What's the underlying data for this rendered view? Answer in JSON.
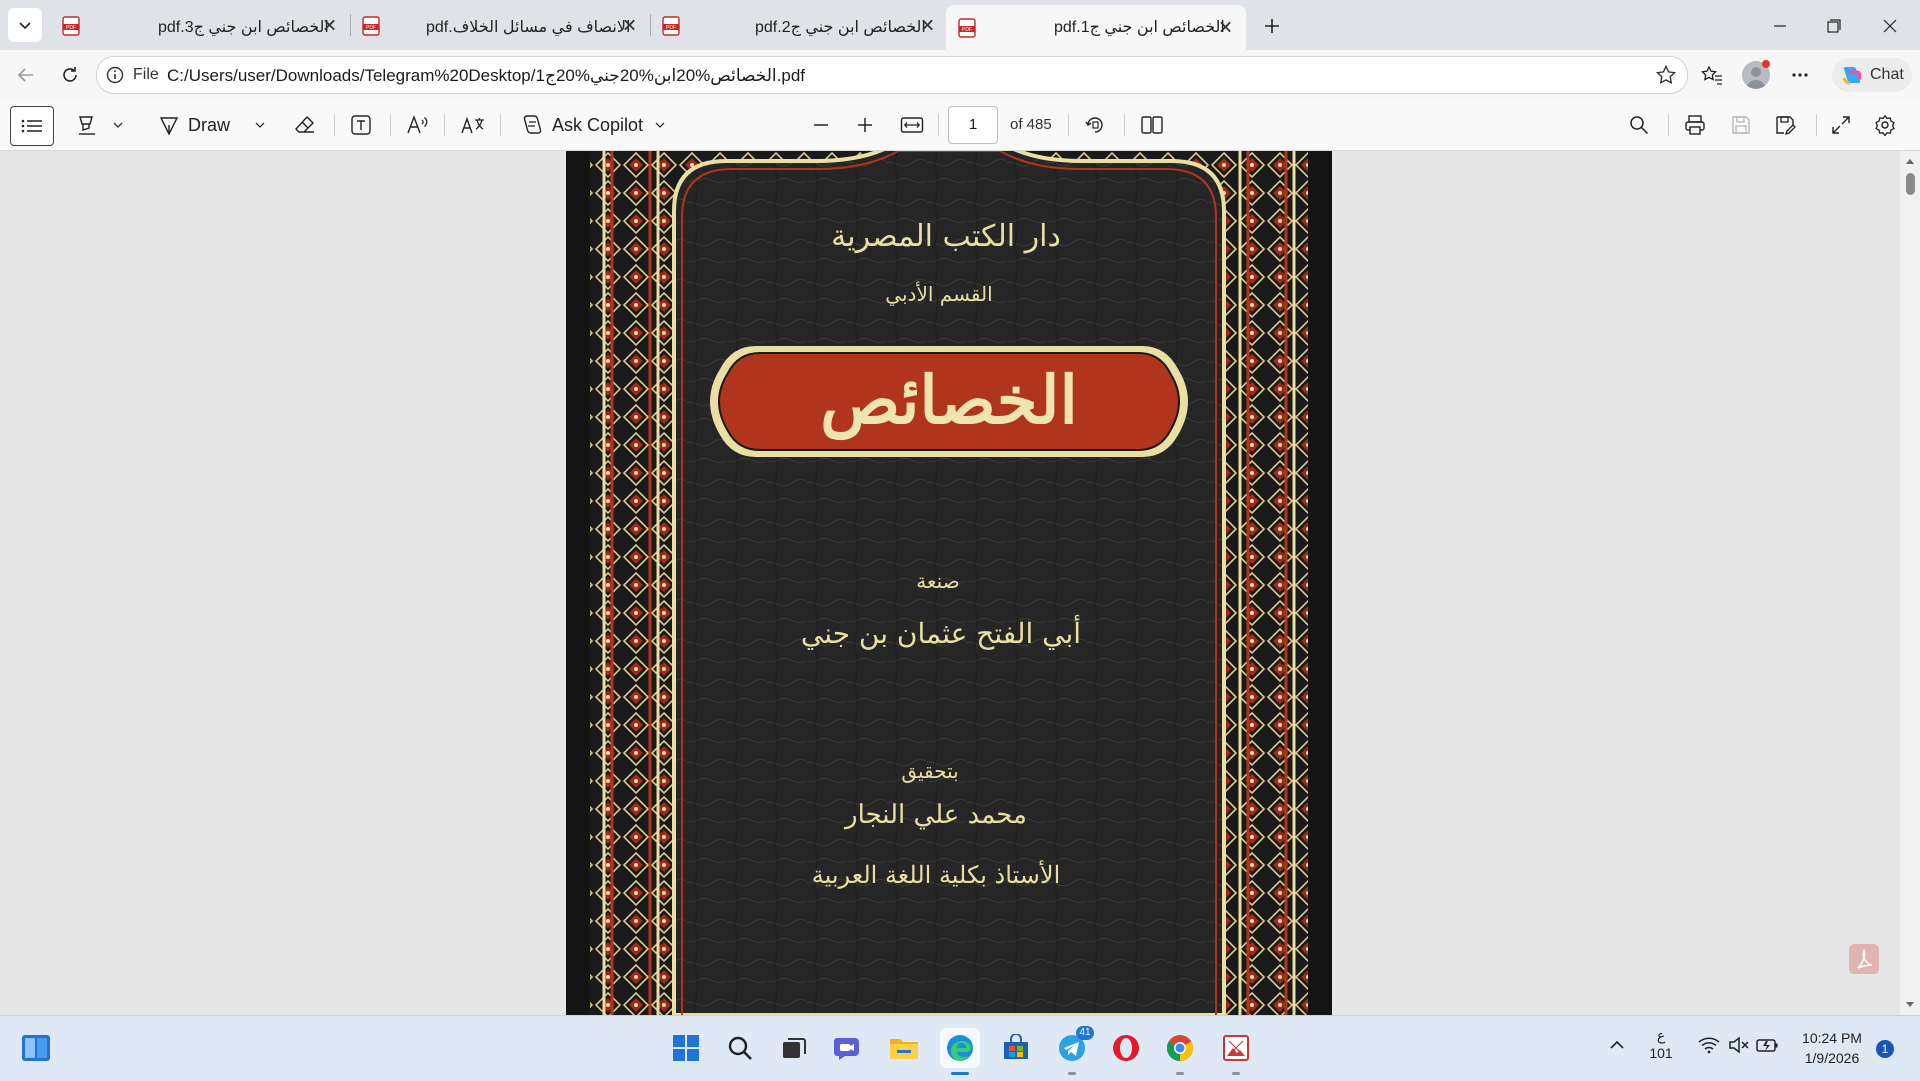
{
  "tabs": [
    {
      "title": "الخصائص ابن جني ج3.pdf",
      "active": false
    },
    {
      "title": "الانصاف في مسائل الخلاف.pdf",
      "active": false
    },
    {
      "title": "الخصائص ابن جني ج2.pdf",
      "active": false
    },
    {
      "title": "الخصائص ابن جني ج1.pdf",
      "active": true
    }
  ],
  "address_bar": {
    "scheme_label": "File",
    "url": "C:/Users/user/Downloads/Telegram%20Desktop/الخصائص%20ابن%20جني%20ج1.pdf",
    "chat_label": "Chat"
  },
  "pdf_toolbar": {
    "draw_label": "Draw",
    "copilot_label": "Ask Copilot",
    "page_number": "1",
    "page_total": "of 485"
  },
  "book_cover": {
    "publisher": "دار الكتب المصرية",
    "section": "القسم الأدبي",
    "title": "الخصائص",
    "crafted_by": "صنعة",
    "author": "أبي الفتح عثمان بن جني",
    "edited_by": "بتحقيق",
    "editor": "محمد علي النجار",
    "editor_title": "الأستاذ بكلية اللغة العربية"
  },
  "taskbar": {
    "telegram_badge": "41",
    "lang_line1": "ع",
    "lang_line2": "101",
    "time": "10:24 PM",
    "date": "1/9/2026",
    "notification_count": "1"
  },
  "colors": {
    "cover_red": "#b1351c",
    "cover_gold": "#e9dfa2",
    "accent_blue": "#1f74d6"
  }
}
